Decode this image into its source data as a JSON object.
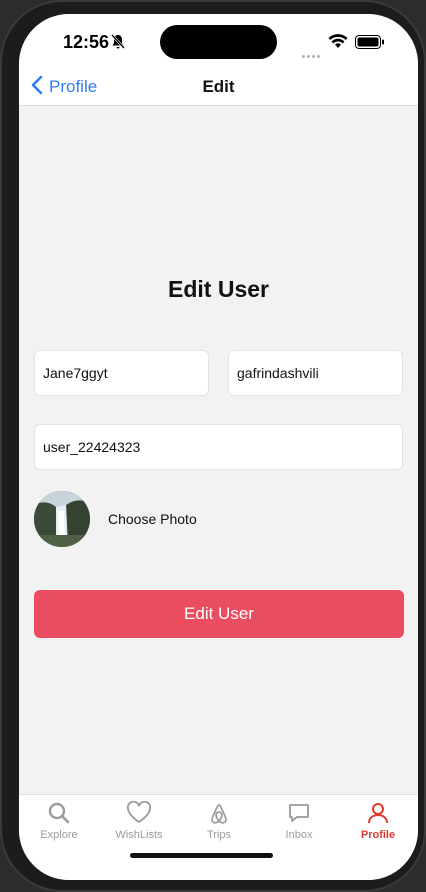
{
  "status_bar": {
    "time": "12:56",
    "icons": [
      "bell-slash-icon",
      "wifi-icon",
      "battery-icon"
    ]
  },
  "nav": {
    "back_label": "Profile",
    "title": "Edit"
  },
  "form": {
    "heading": "Edit User",
    "first_name": "Jane7ggyt",
    "last_name": "gafrindashvili",
    "username": "user_22424323",
    "choose_photo": "Choose Photo",
    "submit_label": "Edit User"
  },
  "tabs": [
    {
      "label": "Explore",
      "icon": "search-icon"
    },
    {
      "label": "WishLists",
      "icon": "heart-icon"
    },
    {
      "label": "Trips",
      "icon": "airbnb-logo-icon"
    },
    {
      "label": "Inbox",
      "icon": "chat-bubble-icon"
    },
    {
      "label": "Profile",
      "icon": "person-icon",
      "active": true
    }
  ],
  "colors": {
    "accent": "#ea4d60",
    "link": "#2f7cf6",
    "active_tab": "#e03a2f",
    "background": "#f2f2f2"
  }
}
